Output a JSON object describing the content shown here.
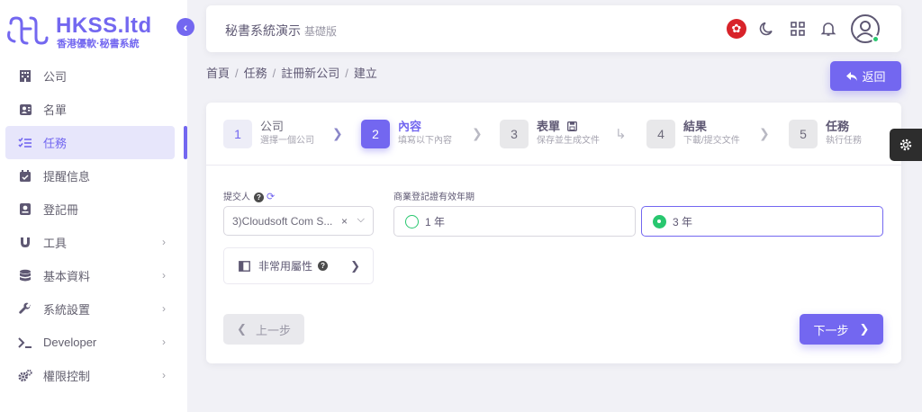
{
  "brand": {
    "name": "HKSS.ltd",
    "tagline": "香港優軟·秘書系統"
  },
  "sidebar": {
    "items": [
      {
        "label": "公司",
        "icon": "building-icon"
      },
      {
        "label": "名單",
        "icon": "contact-card-icon"
      },
      {
        "label": "任務",
        "icon": "task-list-icon",
        "active": true
      },
      {
        "label": "提醒信息",
        "icon": "calendar-check-icon"
      },
      {
        "label": "登記冊",
        "icon": "register-book-icon"
      },
      {
        "label": "工具",
        "icon": "magnet-icon"
      },
      {
        "label": "基本資料",
        "icon": "database-icon"
      },
      {
        "label": "系統設置",
        "icon": "wrench-icon"
      },
      {
        "label": "Developer",
        "icon": "terminal-icon"
      },
      {
        "label": "權限控制",
        "icon": "cogs-icon"
      }
    ]
  },
  "header": {
    "title": "秘書系統演示",
    "edition": "基礎版"
  },
  "breadcrumb": [
    "首頁",
    "任務",
    "註冊新公司",
    "建立"
  ],
  "back_label": "返回",
  "steps": [
    {
      "num": "1",
      "title": "公司",
      "sub": "選擇一個公司"
    },
    {
      "num": "2",
      "title": "內容",
      "sub": "填寫以下內容"
    },
    {
      "num": "3",
      "title": "表單",
      "sub": "保存並生成文件"
    },
    {
      "num": "4",
      "title": "結果",
      "sub": "下載/提交文件"
    },
    {
      "num": "5",
      "title": "任務",
      "sub": "執行任務"
    }
  ],
  "form": {
    "submitter_label": "提交人",
    "submitter_value": "3)Cloudsoft Com S...",
    "validity_label": "商業登記證有效年期",
    "option_1": "1 年",
    "option_3": "3 年",
    "selected_option": "3 年",
    "advanced_label": "非常用屬性"
  },
  "prev_label": "上一步",
  "next_label": "下一步",
  "colors": {
    "accent": "#7367f0",
    "success": "#28c76f"
  }
}
